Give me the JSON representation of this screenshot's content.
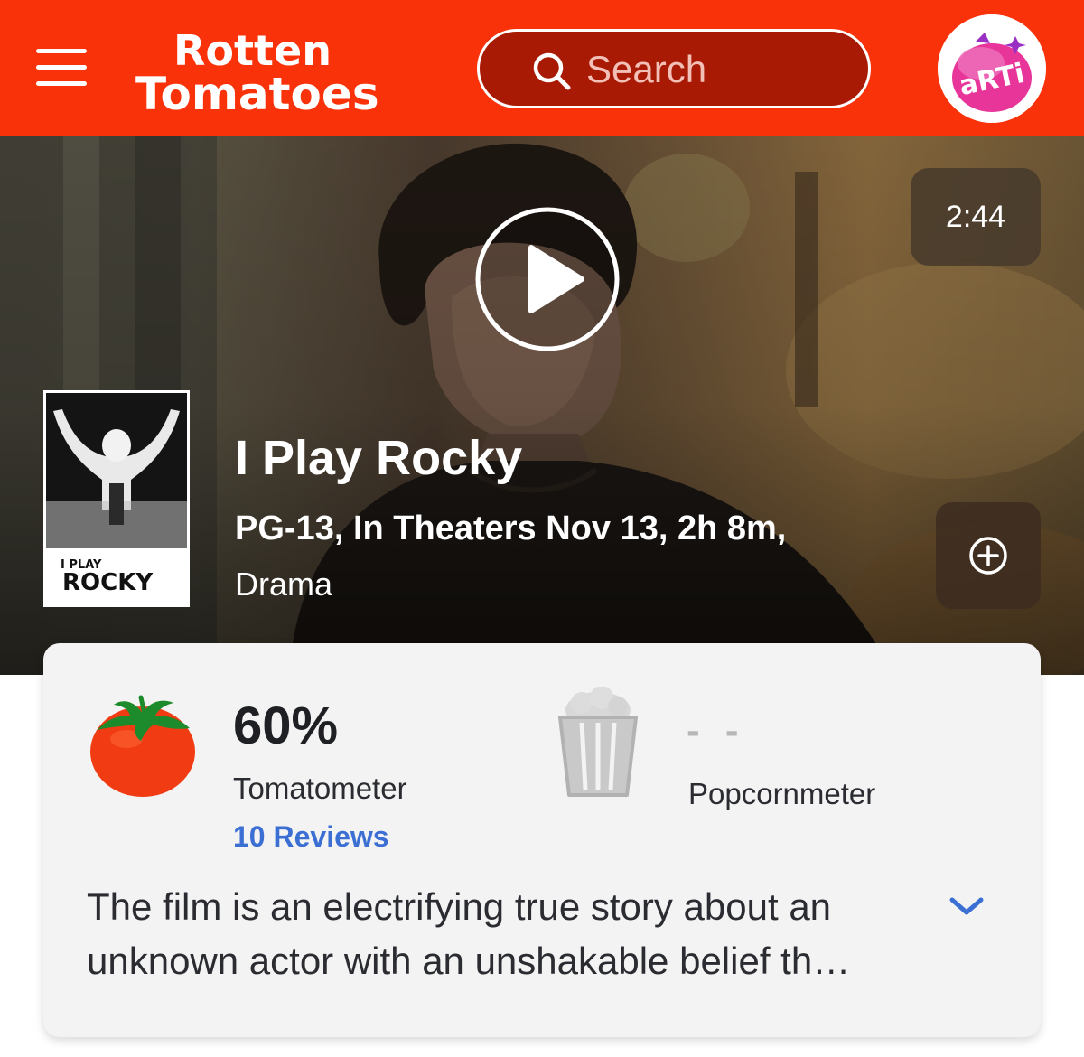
{
  "header": {
    "logo_line1": "Rotten",
    "logo_line2": "Tomatoes",
    "search_placeholder": "Search",
    "avatar_text": "aRTi",
    "background_color": "#fa320a"
  },
  "hero": {
    "duration": "2:44",
    "poster_top": "I PLAY",
    "poster_title": "ROCKY",
    "title": "I Play Rocky",
    "meta": "PG-13, In Theaters Nov 13, 2h 8m,",
    "genre": "Drama"
  },
  "scores": {
    "tomatometer": {
      "value": "60%",
      "label": "Tomatometer",
      "reviews_link": "10 Reviews"
    },
    "popcornmeter": {
      "value": "- -",
      "label": "Popcornmeter"
    },
    "synopsis": "The film is an electrifying true story about an unknown actor with an unshakable belief th…"
  },
  "icons": [
    "menu-icon",
    "search-icon",
    "play-icon",
    "add-circle-icon",
    "tomato-icon",
    "popcorn-bucket-icon",
    "chevron-down-icon"
  ],
  "colors": {
    "accent": "#fa320a",
    "link": "#3b6fd4"
  }
}
